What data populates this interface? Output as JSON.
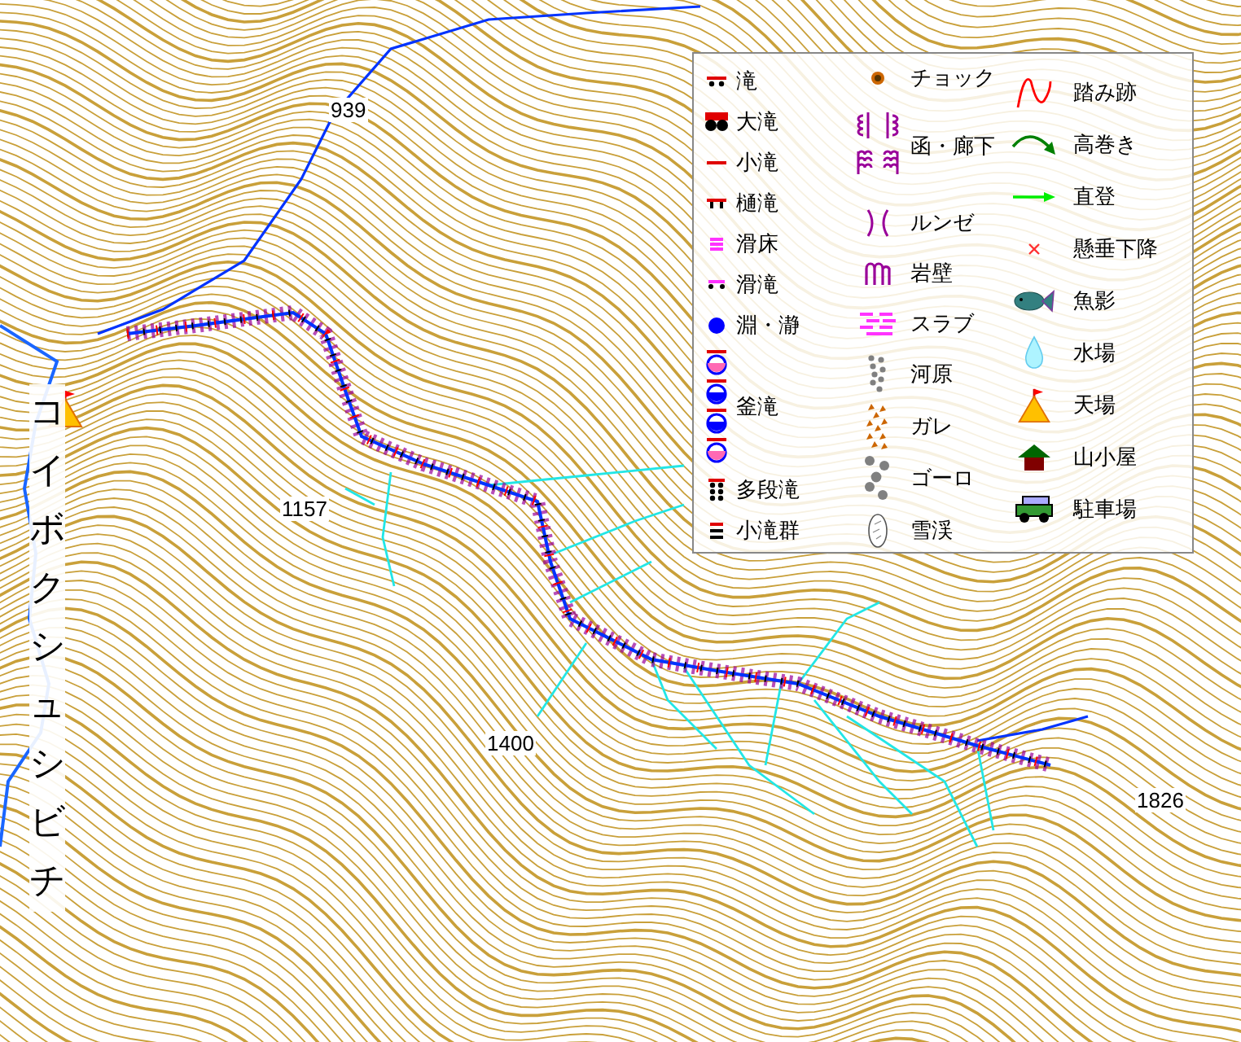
{
  "map": {
    "labels": [
      {
        "kind": "elevation",
        "text": "939"
      },
      {
        "kind": "elevation",
        "text": "1157"
      },
      {
        "kind": "elevation",
        "text": "1400"
      },
      {
        "kind": "elevation",
        "text": "1826"
      },
      {
        "kind": "river-name",
        "text": "コイボクシュシビチ"
      }
    ]
  },
  "legend": {
    "columns": [
      [
        {
          "kind": "falls",
          "label": "滝"
        },
        {
          "kind": "big-falls",
          "label": "大滝"
        },
        {
          "kind": "small-falls",
          "label": "小滝"
        },
        {
          "kind": "trough-falls",
          "label": "樋滝"
        },
        {
          "kind": "slide-bed",
          "label": "滑床"
        },
        {
          "kind": "slide-falls",
          "label": "滑滝"
        },
        {
          "kind": "pool",
          "label": "淵・瀞"
        },
        {
          "kind": "pot-falls",
          "label": "釜滝"
        },
        {
          "kind": "multi-step-falls",
          "label": "多段滝"
        },
        {
          "kind": "small-falls-group",
          "label": "小滝群"
        }
      ],
      [
        {
          "kind": "chockstone",
          "label": "チョック"
        },
        {
          "kind": "gorge",
          "label": "函・廊下"
        },
        {
          "kind": "runnel",
          "label": "ルンゼ"
        },
        {
          "kind": "rock-wall",
          "label": "岩壁"
        },
        {
          "kind": "slab",
          "label": "スラブ"
        },
        {
          "kind": "riverbed",
          "label": "河原"
        },
        {
          "kind": "scree",
          "label": "ガレ"
        },
        {
          "kind": "boulders",
          "label": "ゴーロ"
        },
        {
          "kind": "snow-gully",
          "label": "雪渓"
        }
      ],
      [
        {
          "kind": "trail",
          "label": "踏み跡"
        },
        {
          "kind": "bypass",
          "label": "高巻き"
        },
        {
          "kind": "direct-climb",
          "label": "直登"
        },
        {
          "kind": "rappel",
          "label": "懸垂下降"
        },
        {
          "kind": "fish",
          "label": "魚影"
        },
        {
          "kind": "water-source",
          "label": "水場"
        },
        {
          "kind": "campsite",
          "label": "天場"
        },
        {
          "kind": "hut",
          "label": "山小屋"
        },
        {
          "kind": "parking",
          "label": "駐車場"
        }
      ]
    ]
  }
}
